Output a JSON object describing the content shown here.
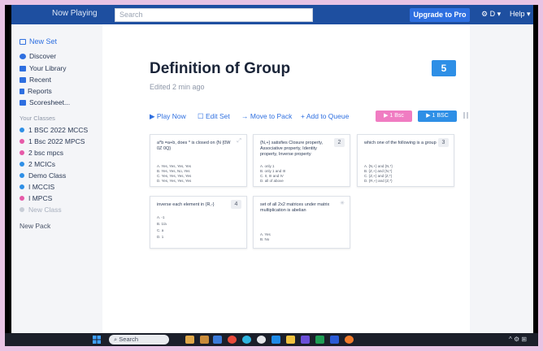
{
  "header": {
    "now_playing": "Now Playing",
    "search_placeholder": "Search",
    "upgrade": "Upgrade to Pro",
    "user": "⚙ D ▾",
    "help": "Help ▾"
  },
  "sidebar": {
    "new_set": "New Set",
    "nav": [
      {
        "label": "Discover",
        "icon": "compass-icon",
        "color": "#2e6fe0"
      },
      {
        "label": "Your Library",
        "icon": "folder-icon",
        "color": "#2e6fe0"
      },
      {
        "label": "Recent",
        "icon": "clock-icon",
        "color": "#2e6fe0"
      },
      {
        "label": "Reports",
        "icon": "report-icon",
        "color": "#2e6fe0"
      },
      {
        "label": "Scoresheet...",
        "icon": "grid-icon",
        "color": "#2e6fe0"
      }
    ],
    "classes_heading": "Your Classes",
    "classes": [
      {
        "label": "1 BSC 2022 MCCS",
        "color": "#2e8fe6"
      },
      {
        "label": "1 Bsc 2022 MPCS",
        "color": "#e65aa8"
      },
      {
        "label": "2 bsc mpcs",
        "color": "#e65aa8"
      },
      {
        "label": "2 MCICs",
        "color": "#2e8fe6"
      },
      {
        "label": "Demo Class",
        "color": "#2e8fe6"
      },
      {
        "label": "I MCCIS",
        "color": "#2e8fe6"
      },
      {
        "label": "I MPCS",
        "color": "#e65aa8"
      }
    ],
    "new_class": "New Class",
    "new_pack": "New Pack"
  },
  "set": {
    "title": "Definition of Group",
    "edited": "Edited 2 min ago",
    "count": "5"
  },
  "actions": {
    "play": "▶ Play Now",
    "edit": "Edit Set",
    "move": "→ Move to Pack",
    "add_queue": "+ Add to Queue",
    "tag1": "▶ 1 Bsc",
    "tag2": "▶ 1 BSC"
  },
  "cards": [
    {
      "num": "1",
      "q": "a*b =a+b, does * is closed on {N {0W 0Z 0Q}",
      "opts": [
        "A. Yes, Yes, Yes, Yes",
        "B. Yes, Yes, No, Yes",
        "C. Yes, Yes, Yes, Yes",
        "D. Yes, Yes, Yes, Yes"
      ]
    },
    {
      "num": "2",
      "q": "{N,+} satisfies Closure property, Associative property, Identity property, Inverse property",
      "opts": [
        "A. only 1",
        "B. only 1 and III",
        "C. II, III and IV",
        "D. all of above"
      ]
    },
    {
      "num": "3",
      "q": "which one of the following is a group",
      "opts": [
        "A. {N,+} and {N,*}",
        "B. {Z,+} and {N,*}",
        "C. {Z,+} and {Z,*}",
        "D. {R,+} and {Z,*}"
      ]
    },
    {
      "num": "4",
      "q": "inverse each element in {R,-}",
      "opts": [
        "A. -1",
        "B. 1/a",
        "C. a",
        "D. 1"
      ]
    },
    {
      "num": "",
      "q": "set of all 2x2 matrices under matrix multiplication is abelian",
      "opts": [
        "A. Yes",
        "B. No"
      ]
    }
  ],
  "taskbar": {
    "search": "Search",
    "tray": "^ ⚙ ⊞"
  },
  "colors": {
    "accent": "#2e6fe0",
    "topbar": "#1e4fa0",
    "badge": "#2e8fe6",
    "tag_pink": "#e65aa8"
  }
}
